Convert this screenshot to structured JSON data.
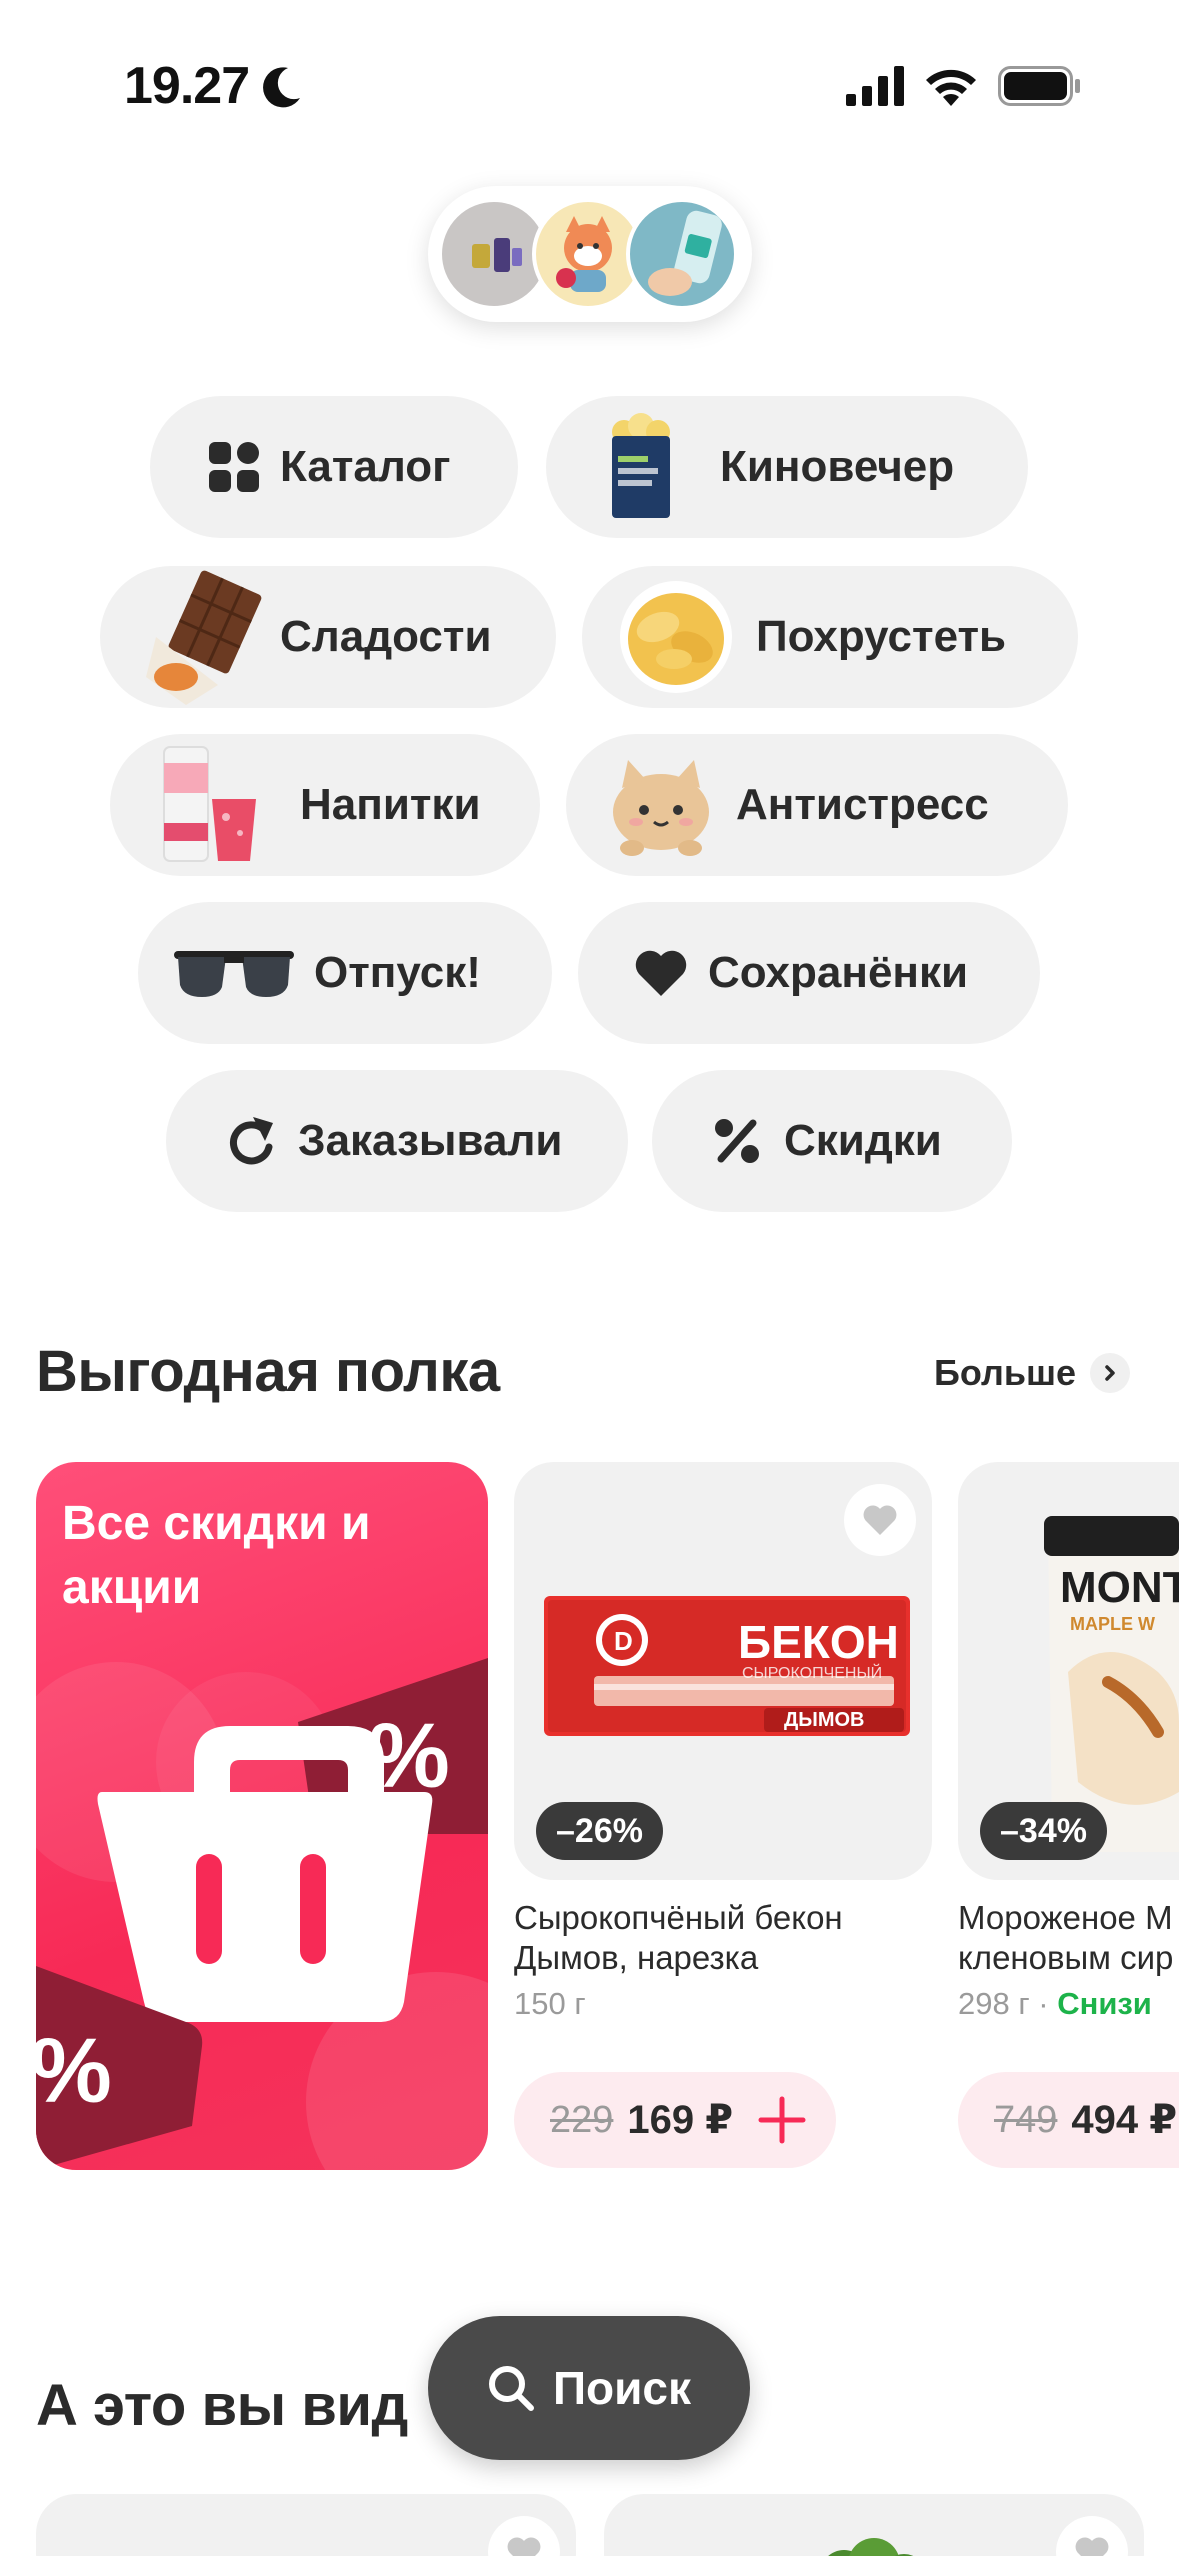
{
  "status_bar": {
    "time": "19.27",
    "icons": [
      "moon-icon",
      "cellular-signal-icon",
      "wifi-icon",
      "battery-icon"
    ]
  },
  "stories": [
    "story-toys",
    "story-fox-sticker",
    "story-cosmetics"
  ],
  "categories": [
    {
      "label": "Каталог",
      "icon": "grid-icon"
    },
    {
      "label": "Киновечер",
      "icon": "popcorn-icon"
    },
    {
      "label": "Сладости",
      "icon": "chocolate-icon"
    },
    {
      "label": "Похрустеть",
      "icon": "chips-icon"
    },
    {
      "label": "Напитки",
      "icon": "drinks-icon"
    },
    {
      "label": "Антистресс",
      "icon": "plush-cat-icon"
    },
    {
      "label": "Отпуск!",
      "icon": "sunglasses-icon"
    },
    {
      "label": "Сохранёнки",
      "icon": "heart-icon"
    },
    {
      "label": "Заказывали",
      "icon": "reorder-icon"
    },
    {
      "label": "Скидки",
      "icon": "percent-icon"
    }
  ],
  "deals_section": {
    "title": "Выгодная полка",
    "more_label": "Больше",
    "promo": {
      "title": "Все скидки и акции"
    },
    "products": [
      {
        "name_line1": "Сырокопчёный бекон",
        "name_line2": "Дымов, нарезка",
        "weight": "150 г",
        "discount": "–26%",
        "old_price": "229",
        "price": "169 ₽",
        "pack_title": "БЕКОН",
        "pack_subtitle": "СЫРОКОПЧЕНЫЙ",
        "pack_brand": "ДЫМОВ"
      },
      {
        "name_line1": "Мороженое М",
        "name_line2": "кленовым сир",
        "weight": "298 г",
        "separator": "·",
        "status": "Снизи",
        "discount": "–34%",
        "old_price": "749",
        "price": "494 ₽",
        "pack_title": "MONT",
        "pack_subtitle": "MAPLE W"
      }
    ]
  },
  "seen_section": {
    "title": "А это вы вид"
  },
  "search_button": {
    "label": "Поиск"
  },
  "colors": {
    "accent": "#f72a56",
    "pill_bg": "#f1f1f1",
    "price_bg": "#fdebef",
    "green": "#1db34a"
  }
}
